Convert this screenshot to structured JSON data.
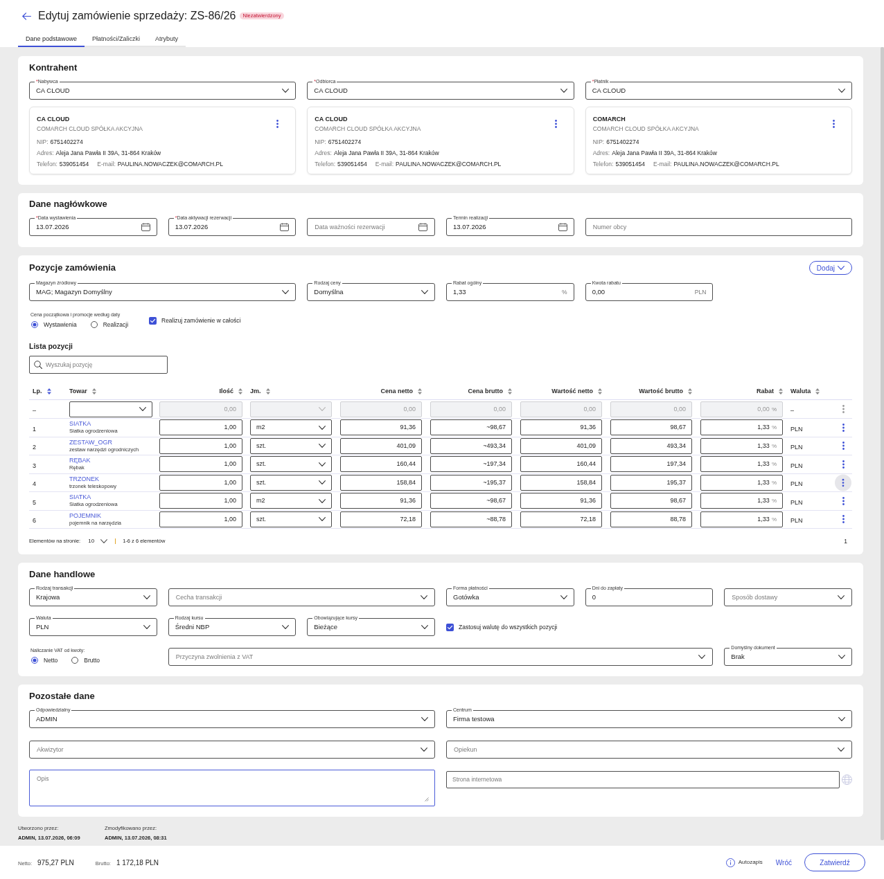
{
  "header": {
    "title": "Edytuj zamówienie sprzedaży: ZS-86/26",
    "status": "Niezatwierdzony"
  },
  "tabs": [
    {
      "label": "Dane podstawowe",
      "selected": true
    },
    {
      "label": "Płatności/Zaliczki",
      "selected": false
    },
    {
      "label": "Atrybuty",
      "selected": false
    }
  ],
  "kontrahent": {
    "title": "Kontrahent",
    "parties": [
      {
        "field": {
          "kind": "select",
          "required_mark": "*",
          "label": "Nabywca",
          "value": "CA CLOUD"
        },
        "card": {
          "code": "CA CLOUD",
          "name": "COMARCH CLOUD SPÓŁKA AKCYJNA",
          "nip_label": "NIP:",
          "nip": "6751402274",
          "address_label": "Adres:",
          "address": "Aleja Jana Pawła II 39A, 31-864 Kraków",
          "phone_label": "Telefon:",
          "phone": "539051454",
          "email_label": "E-mail:",
          "email": "PAULINA.NOWACZEK@COMARCH.PL"
        }
      },
      {
        "field": {
          "kind": "select",
          "required_mark": "*",
          "label": "Odbiorca",
          "value": "CA CLOUD"
        },
        "card": {
          "code": "CA CLOUD",
          "name": "COMARCH CLOUD SPÓŁKA AKCYJNA",
          "nip_label": "NIP:",
          "nip": "6751402274",
          "address_label": "Adres:",
          "address": "Aleja Jana Pawła II 39A, 31-864 Kraków",
          "phone_label": "Telefon:",
          "phone": "539051454",
          "email_label": "E-mail:",
          "email": "PAULINA.NOWACZEK@COMARCH.PL"
        }
      },
      {
        "field": {
          "kind": "select",
          "required_mark": "*",
          "label": "Płatnik",
          "value": "CA CLOUD"
        },
        "card": {
          "code": "COMARCH",
          "name": "COMARCH CLOUD SPÓŁKA AKCYJNA",
          "nip_label": "NIP:",
          "nip": "6751402274",
          "address_label": "Adres:",
          "address": "Aleja Jana Pawła II 39A, 31-864 Kraków",
          "phone_label": "Telefon:",
          "phone": "539051454",
          "email_label": "E-mail:",
          "email": "PAULINA.NOWACZEK@COMARCH.PL"
        }
      }
    ]
  },
  "naglowek": {
    "title": "Dane nagłówkowe",
    "fields": [
      {
        "kind": "date",
        "required_mark": "*",
        "label": "Data wystawienia",
        "value": "13.07.2026"
      },
      {
        "kind": "date",
        "required_mark": "*",
        "label": "Data aktywacji rezerwacji",
        "value": "13.07.2026"
      },
      {
        "kind": "date",
        "placeholder": "Data ważności rezerwacji"
      },
      {
        "kind": "date",
        "label": "Termin realizacji",
        "value": "13.07.2026"
      },
      {
        "kind": "text",
        "placeholder": "Numer obcy"
      }
    ]
  },
  "pozycje": {
    "title": "Pozycje zamówienia",
    "add_button": "Dodaj",
    "fields": [
      {
        "kind": "select",
        "label": "Magazyn źródłowy",
        "value": "MAG; Magazyn Domyślny"
      },
      {
        "kind": "select",
        "label": "Rodzaj ceny",
        "value": "Domyślna"
      },
      {
        "kind": "text",
        "label": "Rabat ogólny",
        "value": "1,33",
        "suffix": "%"
      },
      {
        "kind": "text",
        "label": "Kwota rabatu",
        "value": "0,00",
        "suffix": "PLN"
      }
    ],
    "price_date": {
      "label": "Cena początkowa i promocje według daty",
      "options": [
        {
          "label": "Wystawienia",
          "selected": true
        },
        {
          "label": "Realizacji",
          "selected": false
        }
      ]
    },
    "full_realization": {
      "label": "Realizuj zamówienie w całości",
      "checked": true
    },
    "list_title": "Lista pozycji",
    "search": {
      "placeholder": "Wyszukaj pozycję"
    },
    "table": {
      "columns": [
        {
          "label": "Lp.",
          "sorted": true
        },
        {
          "label": "Towar",
          "sorted": false
        },
        {
          "label": "Ilość",
          "sorted": false
        },
        {
          "label": "Jm.",
          "sorted": false
        },
        {
          "label": "Cena netto",
          "sorted": false
        },
        {
          "label": "Cena brutto",
          "sorted": false
        },
        {
          "label": "Wartość netto",
          "sorted": false
        },
        {
          "label": "Wartość brutto",
          "sorted": false
        },
        {
          "label": "Rabat",
          "sorted": false
        },
        {
          "label": "Waluta",
          "sorted": false
        }
      ],
      "rows": [
        {
          "kind": "entry",
          "disabled": true,
          "highlighted": false,
          "lp": "–",
          "quantity": "0,00",
          "net_price": "0,00",
          "gross_price": "0,00",
          "net_value": "0,00",
          "gross_value": "0,00",
          "discount": "0,00",
          "discount_suffix": "%",
          "currency": "–"
        },
        {
          "kind": "item",
          "disabled": false,
          "highlighted": false,
          "lp": "1",
          "code": "SIATKA",
          "description": "Siatka ogrodzeniowa",
          "quantity": "1,00",
          "unit": "m2",
          "net_price": "91,36",
          "gross_price": "~98,67",
          "net_value": "91,36",
          "gross_value": "98,67",
          "discount": "1,33",
          "discount_suffix": "%",
          "currency": "PLN"
        },
        {
          "kind": "item",
          "disabled": false,
          "highlighted": false,
          "lp": "2",
          "code": "ZESTAW_OGR",
          "description": "zestaw narzędzi ogrodniczych",
          "quantity": "1,00",
          "unit": "szt.",
          "net_price": "401,09",
          "gross_price": "~493,34",
          "net_value": "401,09",
          "gross_value": "493,34",
          "discount": "1,33",
          "discount_suffix": "%",
          "currency": "PLN"
        },
        {
          "kind": "item",
          "disabled": false,
          "highlighted": false,
          "lp": "3",
          "code": "RĘBAK",
          "description": "Rębak",
          "quantity": "1,00",
          "unit": "szt.",
          "net_price": "160,44",
          "gross_price": "~197,34",
          "net_value": "160,44",
          "gross_value": "197,34",
          "discount": "1,33",
          "discount_suffix": "%",
          "currency": "PLN"
        },
        {
          "kind": "item",
          "disabled": false,
          "highlighted": true,
          "lp": "4",
          "code": "TRZONEK",
          "description": "trzonek teleskopowy",
          "quantity": "1,00",
          "unit": "szt.",
          "net_price": "158,84",
          "gross_price": "~195,37",
          "net_value": "158,84",
          "gross_value": "195,37",
          "discount": "1,33",
          "discount_suffix": "%",
          "currency": "PLN"
        },
        {
          "kind": "item",
          "disabled": false,
          "highlighted": false,
          "lp": "5",
          "code": "SIATKA",
          "description": "Siatka ogrodzeniowa",
          "quantity": "1,00",
          "unit": "m2",
          "net_price": "91,36",
          "gross_price": "~98,67",
          "net_value": "91,36",
          "gross_value": "98,67",
          "discount": "1,33",
          "discount_suffix": "%",
          "currency": "PLN"
        },
        {
          "kind": "item",
          "disabled": false,
          "highlighted": false,
          "lp": "6",
          "code": "POJEMNIK",
          "description": "pojemnik na narzędzia",
          "quantity": "1,00",
          "unit": "szt.",
          "net_price": "72,18",
          "gross_price": "~88,78",
          "net_value": "72,18",
          "gross_value": "88,78",
          "discount": "1,33",
          "discount_suffix": "%",
          "currency": "PLN"
        }
      ]
    },
    "pagination": {
      "page_size_label": "Elementów na stronie:",
      "page_size": "10",
      "range": "1-6 z 6 elementów",
      "page": "1"
    }
  },
  "handlowe": {
    "title": "Dane handlowe",
    "fields": [
      {
        "kind": "select",
        "label": "Rodzaj transakcji",
        "value": "Krajowa"
      },
      {
        "kind": "select",
        "placeholder": "Cecha transakcji"
      },
      {
        "kind": "select",
        "label": "Forma płatności",
        "value": "Gotówka"
      },
      {
        "kind": "text",
        "label": "Dni do zapłaty",
        "value": "0"
      },
      {
        "kind": "select",
        "placeholder": "Sposób dostawy"
      },
      {
        "kind": "select",
        "label": "Waluta",
        "value": "PLN"
      },
      {
        "kind": "select",
        "label": "Rodzaj kursu",
        "value": "Średni NBP"
      },
      {
        "kind": "select",
        "label": "Obowiązujące kursy",
        "value": "Bieżące"
      },
      {
        "kind": "checkbox",
        "label": "Zastosuj walutę do wszystkich pozycji",
        "checked": true
      },
      {
        "kind": "radio_group",
        "label": "Naliczanie VAT od kwoty:",
        "options": [
          {
            "label": "Netto",
            "selected": true
          },
          {
            "label": "Brutto",
            "selected": false
          }
        ]
      },
      {
        "kind": "select",
        "placeholder": "Przyczyna zwolnienia z VAT"
      },
      {
        "kind": "select",
        "label": "Domyślny dokument",
        "value": "Brak"
      }
    ]
  },
  "pozostale": {
    "title": "Pozostałe dane",
    "fields": [
      {
        "kind": "select",
        "label": "Odpowiedzialny",
        "value": "ADMIN"
      },
      {
        "kind": "select",
        "label": "Centrum",
        "value": "Firma testowa"
      },
      {
        "kind": "select",
        "placeholder": "Akwizytor"
      },
      {
        "kind": "select",
        "placeholder": "Opiekun"
      },
      {
        "kind": "textarea",
        "placeholder": "Opis",
        "focused": true
      },
      {
        "kind": "url",
        "placeholder": "Strona internetowa"
      }
    ]
  },
  "audit": [
    {
      "label": "Utworzono przez:",
      "value": "ADMIN, 13.07.2026, 06:09"
    },
    {
      "label": "Zmodyfikowano przez:",
      "value": "ADMIN, 13.07.2026, 08:31"
    }
  ],
  "footer": {
    "totals": [
      {
        "label": "Netto:",
        "value": "975,27 PLN"
      },
      {
        "label": "Brutto:",
        "value": "1 172,18 PLN"
      }
    ],
    "autosave": "Autozapis",
    "back": "Wróć",
    "confirm": "Zatwierdź"
  }
}
